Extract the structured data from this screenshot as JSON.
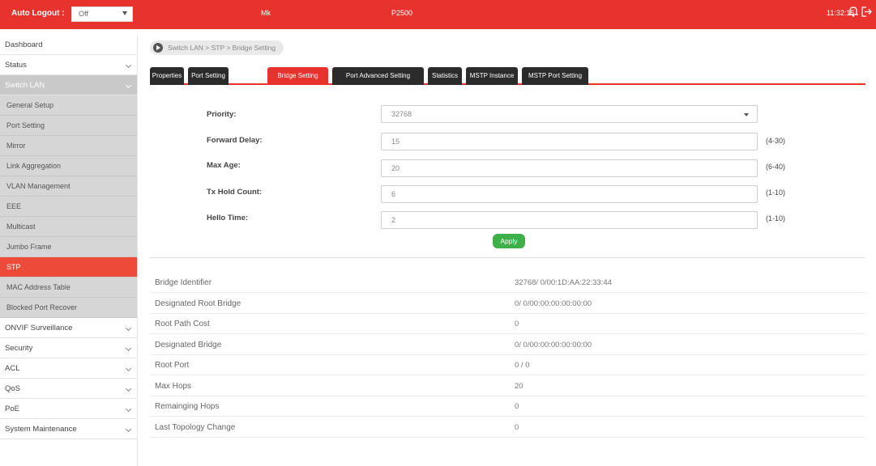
{
  "topbar": {
    "auto_logout_label": "Auto Logout :",
    "auto_logout_value": "Off",
    "mk": "Mk",
    "model": "P2500",
    "clock": "11:32:15"
  },
  "sidebar": {
    "items": [
      {
        "label": "Dashboard",
        "type": "top",
        "chevron": false
      },
      {
        "label": "Status",
        "type": "top",
        "chevron": true
      },
      {
        "label": "Switch LAN",
        "type": "open",
        "chevron": true
      },
      {
        "label": "General Setup",
        "type": "sub"
      },
      {
        "label": "Port Setting",
        "type": "sub"
      },
      {
        "label": "Mirror",
        "type": "sub"
      },
      {
        "label": "Link Aggregation",
        "type": "sub"
      },
      {
        "label": "VLAN Management",
        "type": "sub"
      },
      {
        "label": "EEE",
        "type": "sub"
      },
      {
        "label": "Multicast",
        "type": "sub"
      },
      {
        "label": "Jumbo Frame",
        "type": "sub"
      },
      {
        "label": "STP",
        "type": "sub",
        "active": true
      },
      {
        "label": "MAC Address Table",
        "type": "sub"
      },
      {
        "label": "Blocked Port Recover",
        "type": "sub"
      },
      {
        "label": "ONVIF Surveillance",
        "type": "top",
        "chevron": true
      },
      {
        "label": "Security",
        "type": "top",
        "chevron": true
      },
      {
        "label": "ACL",
        "type": "top",
        "chevron": true
      },
      {
        "label": "QoS",
        "type": "top",
        "chevron": true
      },
      {
        "label": "PoE",
        "type": "top",
        "chevron": true
      },
      {
        "label": "System Maintenance",
        "type": "top",
        "chevron": true
      }
    ]
  },
  "breadcrumb": "Switch LAN > STP > Bridge Setting",
  "tabs": [
    {
      "label": "Properties"
    },
    {
      "label": "Port Setting"
    },
    {
      "label": "Bridge Setting",
      "active": true
    },
    {
      "label": "Port Advanced Setting"
    },
    {
      "label": "Statistics"
    },
    {
      "label": "MSTP Instance"
    },
    {
      "label": "MSTP Port Setting"
    }
  ],
  "form": {
    "priority": {
      "label": "Priority:",
      "value": "32768"
    },
    "forward_delay": {
      "label": "Forward Delay:",
      "value": "15",
      "range": "(4-30)"
    },
    "max_age": {
      "label": "Max Age:",
      "value": "20",
      "range": "(6-40)"
    },
    "tx_hold_count": {
      "label": "Tx Hold Count:",
      "value": "6",
      "range": "(1-10)"
    },
    "hello_time": {
      "label": "Hello Time:",
      "value": "2",
      "range": "(1-10)"
    },
    "apply_label": "Apply"
  },
  "info": [
    {
      "key": "Bridge Identifier",
      "value": "32768/ 0/00:1D:AA:22:33:44"
    },
    {
      "key": "Designated Root Bridge",
      "value": "0/ 0/00:00:00:00:00:00"
    },
    {
      "key": "Root Path Cost",
      "value": "0"
    },
    {
      "key": "Designated Bridge",
      "value": "0/ 0/00:00:00:00:00:00"
    },
    {
      "key": "Root Port",
      "value": "0 / 0"
    },
    {
      "key": "Max Hops",
      "value": "20"
    },
    {
      "key": "Remainging Hops",
      "value": "0"
    },
    {
      "key": "Last Topology Change",
      "value": "0"
    }
  ],
  "colors": {
    "brand": "#e8322e",
    "apply": "#3db04a",
    "tab_dark": "#2b2b2b"
  },
  "icons": [
    "bell-icon",
    "logout-icon",
    "breadcrumb-play-icon"
  ]
}
